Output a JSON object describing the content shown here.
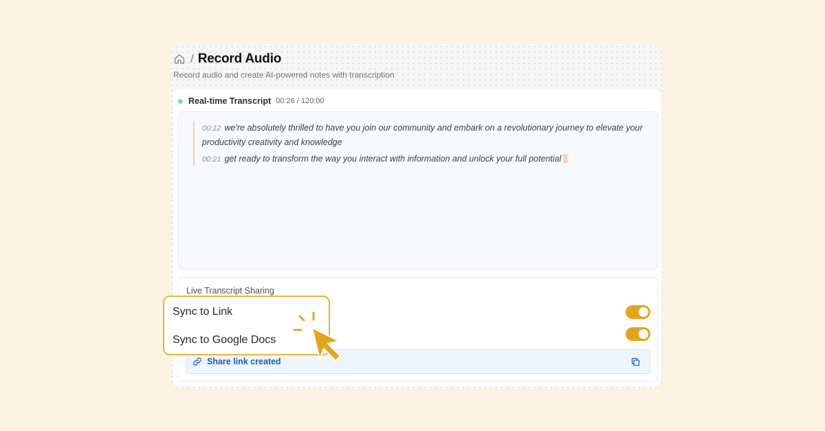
{
  "header": {
    "separator": "/",
    "title": "Record Audio",
    "subtitle": "Record audio and create AI-powered notes with transcription",
    "home_icon": "home-icon"
  },
  "transcript": {
    "label": "Real-time Transcript",
    "time": "00:26 / 120:00",
    "status_color": "#86d49f",
    "lines": [
      {
        "timestamp": "00:12",
        "text": "we're absolutely thrilled to have you join our community and embark on a revolutionary journey to elevate your productivity creativity and knowledge"
      },
      {
        "timestamp": "00:21",
        "text": "get ready to transform the way you interact with information and unlock your full potential"
      }
    ]
  },
  "sharing": {
    "title": "Live Transcript Sharing",
    "options": [
      {
        "label": "Sync to Link",
        "enabled": true
      },
      {
        "label": "Sync to Google Docs",
        "enabled": true
      }
    ],
    "share_text": "Share link created",
    "link_icon": "link-icon",
    "copy_icon": "copy-icon"
  },
  "colors": {
    "background": "#fcf3e2",
    "accent": "#e3a51f",
    "link_text": "#1e5ba8"
  }
}
